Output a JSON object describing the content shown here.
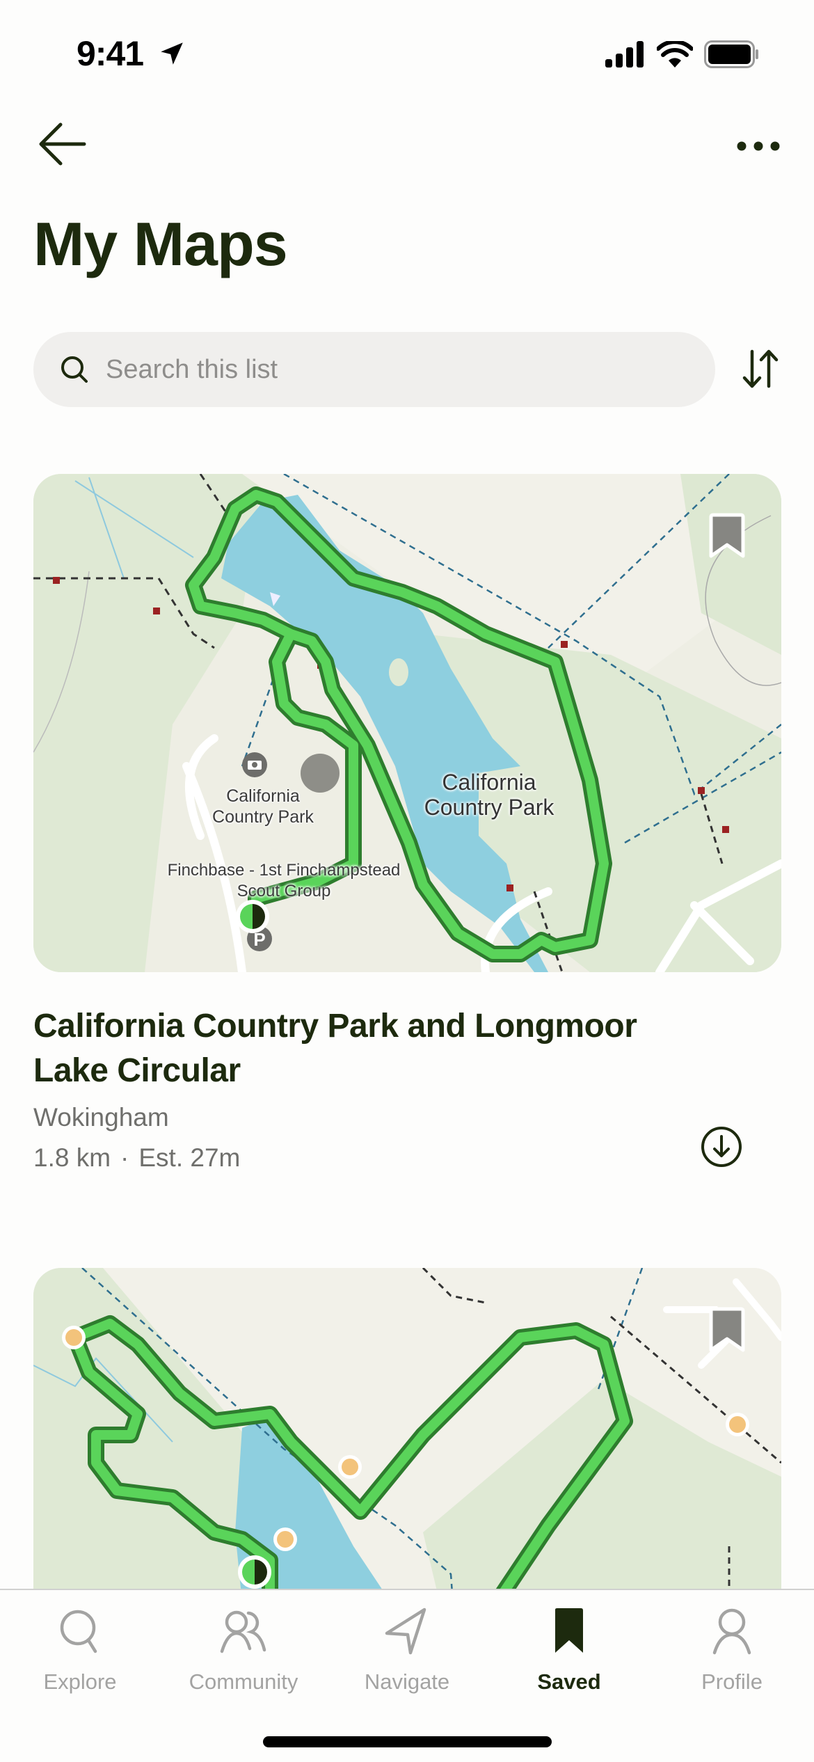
{
  "status_bar": {
    "time": "9:41",
    "icons": [
      "location-arrow-icon",
      "cellular-signal-icon",
      "wifi-icon",
      "battery-icon"
    ]
  },
  "nav": {
    "back_icon": "arrow-left-icon",
    "more_icon": "ellipsis-icon"
  },
  "page": {
    "title": "My Maps"
  },
  "search": {
    "placeholder": "Search this list",
    "value": "",
    "sort_icon": "sort-arrows-icon"
  },
  "colors": {
    "accent_dark": "#1d2a0e",
    "route_green": "#5ad45a",
    "water": "#8ecfdf",
    "park": "#dfe9d4",
    "waypoint": "#f3c37b"
  },
  "routes": [
    {
      "title": "California Country Park and Longmoor Lake Circular",
      "region": "Wokingham",
      "distance": "1.8 km",
      "separator": "·",
      "estimate": "Est. 27m",
      "saved": true,
      "map_labels": [
        "California Country Park",
        "California Country Park",
        "Finchbase - 1st Finchampstead Scout Group"
      ]
    },
    {
      "title": "",
      "saved": true,
      "map_labels": []
    }
  ],
  "tab_bar": {
    "tabs": [
      {
        "label": "Explore",
        "icon": "search-icon",
        "active": false
      },
      {
        "label": "Community",
        "icon": "community-icon",
        "active": false
      },
      {
        "label": "Navigate",
        "icon": "navigate-icon",
        "active": false
      },
      {
        "label": "Saved",
        "icon": "bookmark-icon",
        "active": true
      },
      {
        "label": "Profile",
        "icon": "profile-icon",
        "active": false
      }
    ]
  }
}
